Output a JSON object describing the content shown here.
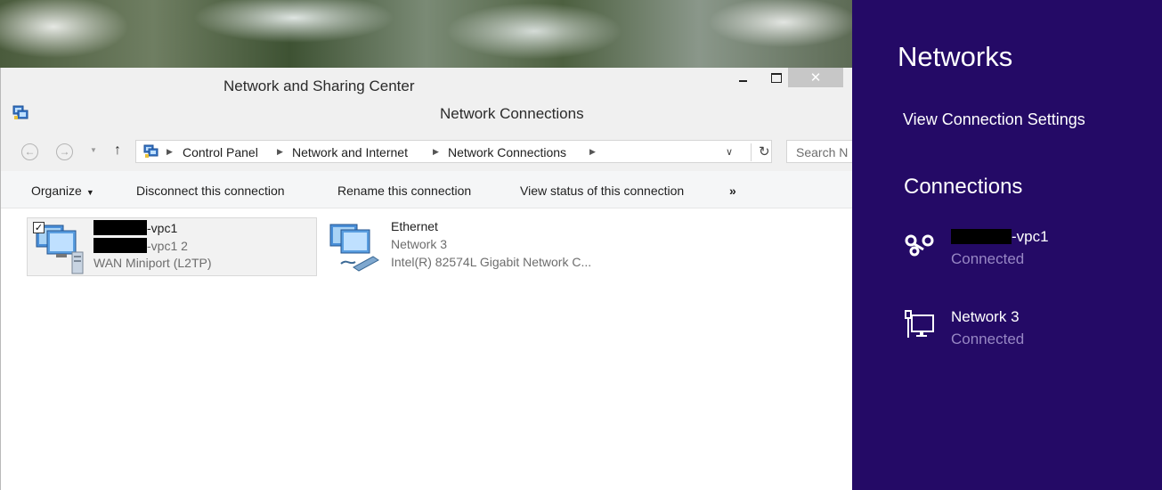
{
  "outer_window": {
    "title": "Network and Sharing Center",
    "close_glyph": "✕"
  },
  "inner_window": {
    "title": "Network Connections"
  },
  "address_bar": {
    "crumbs": [
      "Control Panel",
      "Network and Internet",
      "Network Connections"
    ],
    "search_placeholder": "Search N"
  },
  "command_bar": {
    "organize": "Organize",
    "disconnect": "Disconnect this connection",
    "rename": "Rename this connection",
    "view_status": "View status of this connection",
    "more": "»"
  },
  "connections": [
    {
      "name_suffix": "-vpc1",
      "sub_suffix": "-vpc1  2",
      "device": "WAN Miniport (L2TP)",
      "selected": true
    },
    {
      "name": "Ethernet",
      "sub": "Network  3",
      "device": "Intel(R) 82574L Gigabit Network C..."
    }
  ],
  "charms": {
    "title": "Networks",
    "view_settings": "View Connection Settings",
    "connections_header": "Connections",
    "networks": [
      {
        "name_suffix": "-vpc1",
        "status": "Connected",
        "icon": "vpn-link-icon"
      },
      {
        "name": "Network  3",
        "status": "Connected",
        "icon": "wired-monitor-icon"
      }
    ],
    "bg_color": "#240a66",
    "status_color": "#9787c4"
  }
}
